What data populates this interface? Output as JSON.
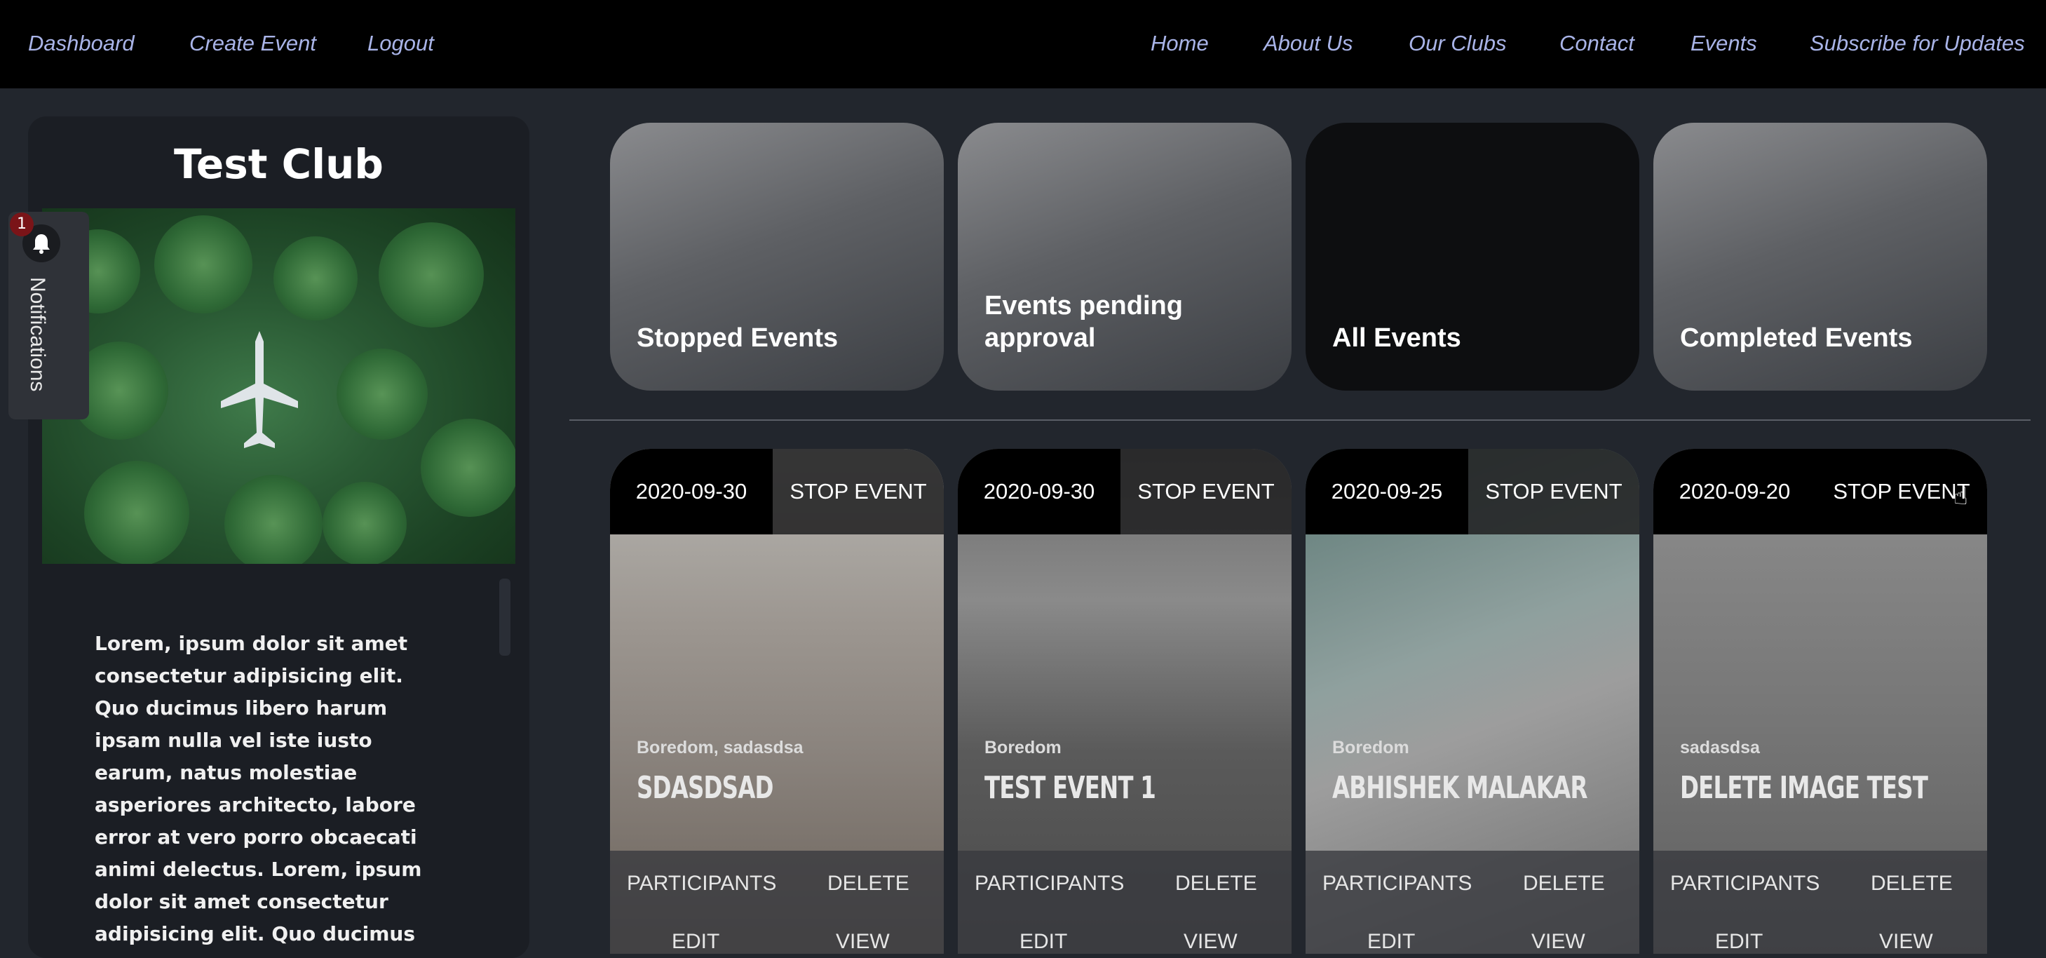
{
  "nav_left": [
    "Dashboard",
    "Create Event",
    "Logout"
  ],
  "nav_right": [
    "Home",
    "About Us",
    "Our Clubs",
    "Contact",
    "Events",
    "Subscribe for Updates"
  ],
  "sidebar": {
    "club_name": "Test Club",
    "description": "Lorem, ipsum dolor sit amet consectetur adipisicing elit. Quo ducimus libero harum ipsam nulla vel iste iusto earum, natus molestiae asperiores architecto, labore error at vero porro obcaecati animi delectus. Lorem, ipsum dolor sit amet consectetur adipisicing elit. Quo ducimus"
  },
  "notifications": {
    "label": "Notifications",
    "count": "1",
    "icon": "bell-icon"
  },
  "filters": [
    {
      "label": "Stopped Events"
    },
    {
      "label": "Events pending approval"
    },
    {
      "label": "All Events"
    },
    {
      "label": "Completed Events"
    }
  ],
  "events": [
    {
      "date": "2020-09-30",
      "action": "STOP EVENT",
      "tags": "Boredom, sadasdsa",
      "title": "SDASDSAD",
      "participants": "PARTICIPANTS",
      "delete": "DELETE",
      "edit": "EDIT",
      "view": "VIEW"
    },
    {
      "date": "2020-09-30",
      "action": "STOP EVENT",
      "tags": "Boredom",
      "title": "TEST EVENT 1",
      "participants": "PARTICIPANTS",
      "delete": "DELETE",
      "edit": "EDIT",
      "view": "VIEW"
    },
    {
      "date": "2020-09-25",
      "action": "STOP EVENT",
      "tags": "Boredom",
      "title": "ABHISHEK MALAKAR",
      "participants": "PARTICIPANTS",
      "delete": "DELETE",
      "edit": "EDIT",
      "view": "VIEW"
    },
    {
      "date": "2020-09-20",
      "action": "STOP EVENT",
      "tags": "sadasdsa",
      "title": "DELETE IMAGE TEST",
      "participants": "PARTICIPANTS",
      "delete": "DELETE",
      "edit": "EDIT",
      "view": "VIEW"
    }
  ]
}
